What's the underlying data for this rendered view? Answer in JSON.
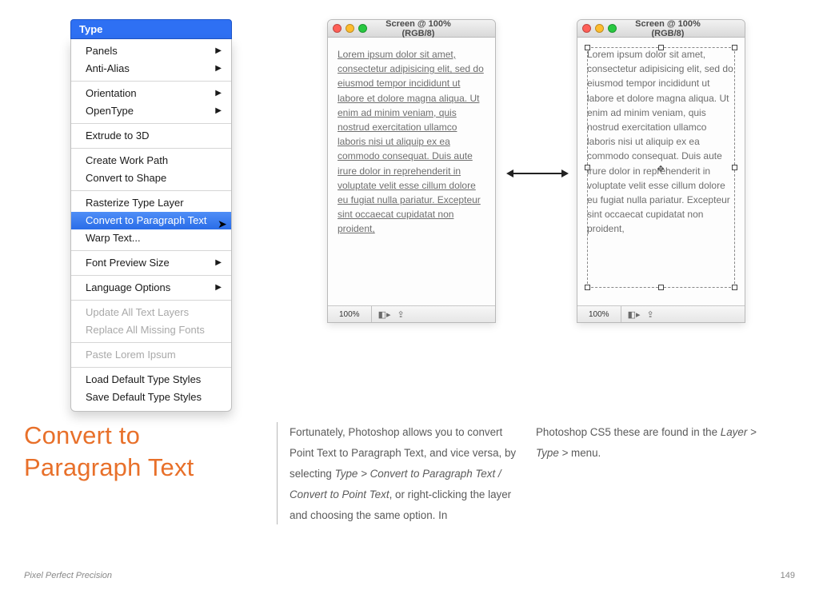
{
  "menu": {
    "title": "Type",
    "items": [
      {
        "label": "Panels",
        "submenu": true
      },
      {
        "label": "Anti-Alias",
        "submenu": true
      },
      {
        "sep": true
      },
      {
        "label": "Orientation",
        "submenu": true
      },
      {
        "label": "OpenType",
        "submenu": true
      },
      {
        "sep": true
      },
      {
        "label": "Extrude to 3D"
      },
      {
        "sep": true
      },
      {
        "label": "Create Work Path"
      },
      {
        "label": "Convert to Shape"
      },
      {
        "sep": true
      },
      {
        "label": "Rasterize Type Layer"
      },
      {
        "label": "Convert to Paragraph Text",
        "highlight": true
      },
      {
        "label": "Warp Text..."
      },
      {
        "sep": true
      },
      {
        "label": "Font Preview Size",
        "submenu": true
      },
      {
        "sep": true
      },
      {
        "label": "Language Options",
        "submenu": true
      },
      {
        "sep": true
      },
      {
        "label": "Update All Text Layers",
        "disabled": true
      },
      {
        "label": "Replace All Missing Fonts",
        "disabled": true
      },
      {
        "sep": true
      },
      {
        "label": "Paste Lorem Ipsum",
        "disabled": true
      },
      {
        "sep": true
      },
      {
        "label": "Load Default Type Styles"
      },
      {
        "label": "Save Default Type Styles"
      }
    ]
  },
  "window": {
    "title": "Screen @ 100% (RGB/8)",
    "zoom": "100%",
    "lorem": "Lorem ipsum dolor sit amet, consectetur adipisicing elit, sed do eiusmod tempor incididunt ut labore et dolore magna aliqua. Ut enim ad minim veniam, quis nostrud exercitation ullamco laboris nisi ut aliquip ex ea commodo consequat. Duis aute irure dolor in reprehenderit in voluptate velit esse cillum dolore eu fugiat nulla pariatur. Excepteur sint occaecat cupidatat non proident,"
  },
  "article": {
    "heading_line1": "Convert to",
    "heading_line2": "Paragraph Text",
    "col1_pre": "Fortunately, Photoshop allows you to convert Point Text to Paragraph Text, and vice versa, by selecting ",
    "col1_ital": "Type > Convert to Paragraph Text / Convert to Point Text",
    "col1_post": ", or right-clicking the layer and choosing the same option. In",
    "col2_pre": "Photoshop CS5 these are found in the ",
    "col2_ital": "Layer > Type >",
    "col2_post": " menu."
  },
  "footer": {
    "left": "Pixel Perfect Precision",
    "right": "149"
  }
}
